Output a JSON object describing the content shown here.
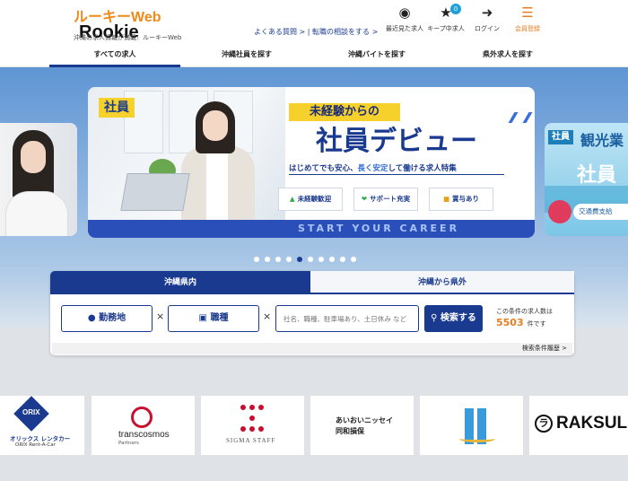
{
  "header": {
    "logo": {
      "brand_latin": "Rookie",
      "brand_jp": "ルーキーWeb",
      "tagline": "沖縄の求人情報が満載！ルーキーWeb"
    },
    "links": {
      "faq": "よくある質問 >",
      "consult": "転職の相談をする >"
    },
    "icons": [
      {
        "name": "eye-icon",
        "label": "最近見た求人"
      },
      {
        "name": "star-icon",
        "label": "キープ中求人",
        "badge": "0"
      },
      {
        "name": "login-icon",
        "label": "ログイン"
      },
      {
        "name": "register-icon",
        "label": "会員登録"
      }
    ]
  },
  "nav": {
    "items": [
      "すべての求人",
      "沖縄社員を探す",
      "沖縄バイトを探す",
      "県外求人を探す"
    ],
    "active": 0
  },
  "banner": {
    "tag": "社員",
    "kicker": "未経験からの",
    "title": "社員デビュー",
    "subtitle_a": "はじめてでも安心、",
    "subtitle_em": "長く安定",
    "subtitle_b": "して働ける求人特集",
    "chips": [
      "未経験歓迎",
      "サポート充実",
      "賞与あり"
    ],
    "footer": "START YOUR CAREER"
  },
  "banner_right": {
    "tag": "社員",
    "title": "観光業",
    "big": "社員",
    "pill": "交通費支給"
  },
  "carousel": {
    "count": 10,
    "active_index": 4
  },
  "search": {
    "tabs": [
      "沖縄県内",
      "沖縄から県外"
    ],
    "location_label": "勤務地",
    "category_label": "職種",
    "keyword_placeholder": "社名、職種、駐車場あり、土日休み など",
    "button": "検索する",
    "count_label": "この条件の求人数は",
    "count_value": "5503",
    "count_unit": "件です",
    "history": "検索条件履歴 >"
  },
  "partners": [
    {
      "name": "オリックス レンタカー",
      "sub": "ORIX Rent-A-Car",
      "mark": "ORIX"
    },
    {
      "name": "transcosmos",
      "sub": "Partners"
    },
    {
      "name": "SIGMA STAFF"
    },
    {
      "name": "あいおいニッセイ",
      "sub": "同和損保"
    },
    {
      "name": "IL"
    },
    {
      "name": "RAKSUL",
      "mark": "ラ"
    }
  ]
}
